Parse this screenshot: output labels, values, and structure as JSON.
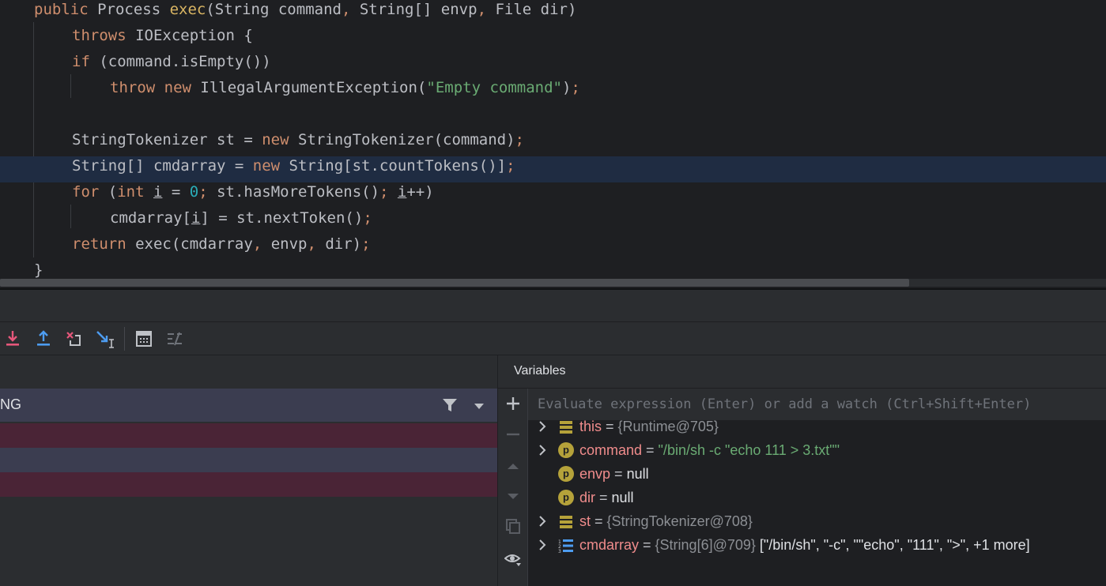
{
  "editor": {
    "lines": [
      {
        "parts": [
          [
            "kw",
            "public "
          ],
          [
            "t",
            "Process "
          ],
          [
            "fn",
            "exec"
          ],
          [
            "t",
            "(String command"
          ],
          [
            "kw",
            ","
          ],
          [
            "t",
            " String[] envp"
          ],
          [
            "kw",
            ","
          ],
          [
            "t",
            " File dir)"
          ]
        ]
      },
      {
        "parts": [
          [
            "kw",
            "throws "
          ],
          [
            "t",
            "IOException {"
          ]
        ]
      },
      {
        "parts": [
          [
            "kw",
            "if "
          ],
          [
            "t",
            "(command.isEmpty())"
          ]
        ]
      },
      {
        "parts": [
          [
            "kw",
            "throw new "
          ],
          [
            "t",
            "IllegalArgumentException("
          ],
          [
            "str",
            "\"Empty command\""
          ],
          [
            "t",
            ")"
          ],
          [
            "kw",
            ";"
          ]
        ]
      },
      {
        "parts": []
      },
      {
        "parts": [
          [
            "t",
            "StringTokenizer st = "
          ],
          [
            "kw",
            "new "
          ],
          [
            "t",
            "StringTokenizer(command)"
          ],
          [
            "kw",
            ";"
          ]
        ]
      },
      {
        "parts": [
          [
            "t",
            "String[] cmdarray = "
          ],
          [
            "kw",
            "new "
          ],
          [
            "t",
            "String[st.countTokens()]"
          ],
          [
            "kw",
            ";"
          ]
        ]
      },
      {
        "parts": [
          [
            "kw",
            "for "
          ],
          [
            "t",
            "("
          ],
          [
            "kw",
            "int "
          ],
          [
            "ul",
            "i"
          ],
          [
            "t",
            " = "
          ],
          [
            "num",
            "0"
          ],
          [
            "kw",
            "; "
          ],
          [
            "t",
            "st.hasMoreTokens()"
          ],
          [
            "kw",
            "; "
          ],
          [
            "ul",
            "i"
          ],
          [
            "t",
            "++)"
          ]
        ]
      },
      {
        "parts": [
          [
            "t",
            "cmdarray["
          ],
          [
            "ul",
            "i"
          ],
          [
            "t",
            "] = st.nextToken()"
          ],
          [
            "kw",
            ";"
          ]
        ]
      },
      {
        "parts": [
          [
            "kw",
            "return "
          ],
          [
            "t",
            "exec(cmdarray"
          ],
          [
            "kw",
            ", "
          ],
          [
            "t",
            "envp"
          ],
          [
            "kw",
            ", "
          ],
          [
            "t",
            "dir)"
          ],
          [
            "kw",
            ";"
          ]
        ]
      },
      {
        "parts": [
          [
            "t",
            "}"
          ]
        ]
      }
    ]
  },
  "frames": {
    "filter_label": "NG"
  },
  "variables": {
    "title": "Variables",
    "eval_placeholder": "Evaluate expression (Enter) or add a watch (Ctrl+Shift+Enter)",
    "rows": [
      {
        "expandable": true,
        "icon": "field-icon",
        "name": "this",
        "eq": " = ",
        "value": "{Runtime@705}",
        "value_kind": "ref",
        "extra": ""
      },
      {
        "expandable": true,
        "icon": "param-icon",
        "name": "command",
        "eq": " = ",
        "value": "\"/bin/sh -c \"echo 111 > 3.txt\"\"",
        "value_kind": "str",
        "extra": ""
      },
      {
        "expandable": false,
        "icon": "param-icon",
        "name": "envp",
        "eq": " = ",
        "value": "null",
        "value_kind": "plain",
        "extra": ""
      },
      {
        "expandable": false,
        "icon": "param-icon",
        "name": "dir",
        "eq": " = ",
        "value": "null",
        "value_kind": "plain",
        "extra": ""
      },
      {
        "expandable": true,
        "icon": "field-icon",
        "name": "st",
        "eq": " = ",
        "value": "{StringTokenizer@708}",
        "value_kind": "ref",
        "extra": ""
      },
      {
        "expandable": true,
        "icon": "array-icon",
        "name": "cmdarray",
        "eq": " = ",
        "value": "{String[6]@709}",
        "value_kind": "ref",
        "extra": " [\"/bin/sh\", \"-c\", \"\"echo\", \"111\", \">\", +1 more]"
      }
    ]
  },
  "colors": {
    "keyword": "#cf8e6d",
    "function": "#d9b563",
    "string": "#6aab73",
    "number": "#2aacb8",
    "var_name": "#f08c8c",
    "frame_row_pink": "#4a2436",
    "frame_row_selected": "#3b3d50"
  }
}
